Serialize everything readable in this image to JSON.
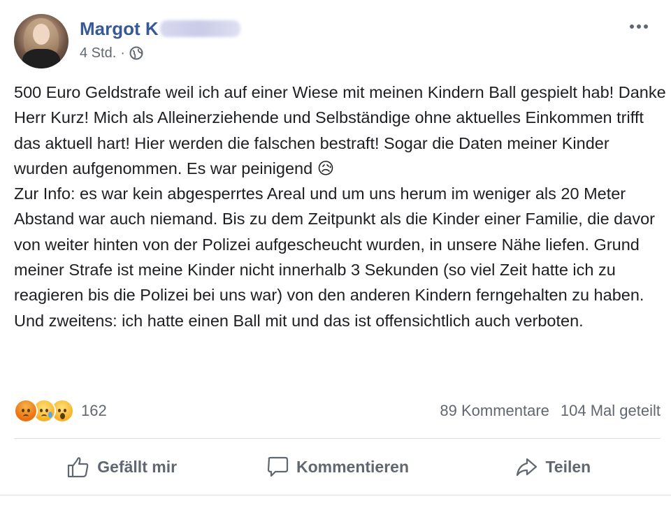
{
  "post": {
    "author": {
      "name": "Margot K",
      "name_redacted": true
    },
    "meta": {
      "time": "4 Std.",
      "separator": "·",
      "audience_icon": "globe-icon"
    },
    "more_icon": "more-options-icon",
    "text": "500 Euro Geldstrafe weil ich auf einer Wiese mit meinen Kindern Ball gespielt hab! Danke Herr Kurz! Mich als Alleinerziehende und Selbständige ohne aktuelles Einkommen trifft das aktuell hart! Hier werden die falschen bestraft! Sogar die Daten meiner Kinder wurden aufgenommen. Es war peinigend 😥\nZur Info: es war kein abgesperrtes Areal und um uns herum im weniger als 20 Meter Abstand war auch niemand. Bis zu dem Zeitpunkt als die Kinder einer Familie, die davor von weiter hinten von der Polizei aufgescheucht wurden, in unsere Nähe liefen. Grund meiner Strafe ist meine Kinder nicht innerhalb 3 Sekunden (so viel Zeit hatte ich zu reagieren bis die Polizei bei uns war) von den anderen Kindern ferngehalten zu haben. Und zweitens: ich hatte einen Ball mit und das ist offensichtlich auch verboten."
  },
  "engagement": {
    "reactions": [
      "angry-reaction-icon",
      "sad-reaction-icon",
      "wow-reaction-icon"
    ],
    "reaction_count": "162",
    "comments": "89 Kommentare",
    "shares": "104 Mal geteilt"
  },
  "actions": {
    "like": {
      "label": "Gefällt mir",
      "icon": "thumbs-up-icon"
    },
    "comment": {
      "label": "Kommentieren",
      "icon": "comment-icon"
    },
    "share": {
      "label": "Teilen",
      "icon": "share-icon"
    }
  }
}
